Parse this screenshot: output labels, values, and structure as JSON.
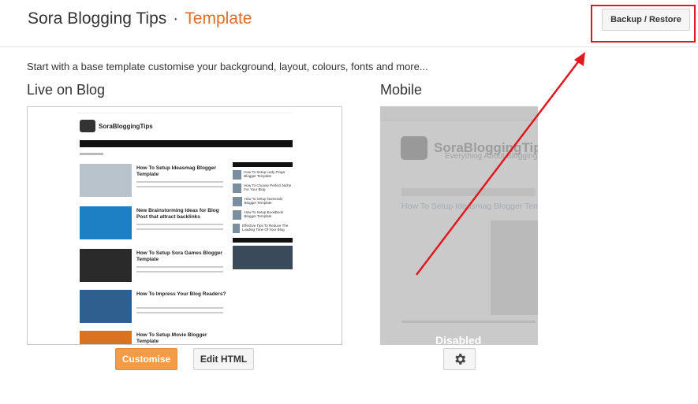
{
  "header": {
    "blog_name": "Sora Blogging Tips",
    "separator": "·",
    "section": "Template",
    "backup_label": "Backup / Restore"
  },
  "intro": "Start with a base template customise your background, layout, colours, fonts and more...",
  "live": {
    "heading": "Live on Blog",
    "logo_text": "SoraBloggingTips",
    "posts": [
      "How To Setup Ideasmag Blogger Template",
      "New Brainstorming Ideas for Blog Post that attract backlinks",
      "How To Setup Sora Games Blogger Template",
      "How To Impress Your Blog Readers?",
      "How To Setup Movie Blogger Template"
    ],
    "sidebar_items": [
      "How To Setup Lady Pinga Blogger Template",
      "How To Choose Perfect Niche For Your Blog",
      "How To Setup Numerals Blogger Template",
      "How To Setup BookBook Blogger Template",
      "Effective Tips To Reduce The Loading Time Of Your Blog"
    ],
    "customise_label": "Customise",
    "edit_html_label": "Edit HTML"
  },
  "mobile": {
    "heading": "Mobile",
    "logo_text": "SoraBloggingTips",
    "tagline": "Everything About Blogging",
    "post_title": "How To Setup Ideasmag Blogger Template",
    "disabled_label": "Disabled"
  },
  "colors": {
    "accent": "#dd6d2c",
    "customise_button": "#f29c4a",
    "annotation": "#e0191f"
  },
  "icons": {
    "settings": "gear-icon"
  }
}
